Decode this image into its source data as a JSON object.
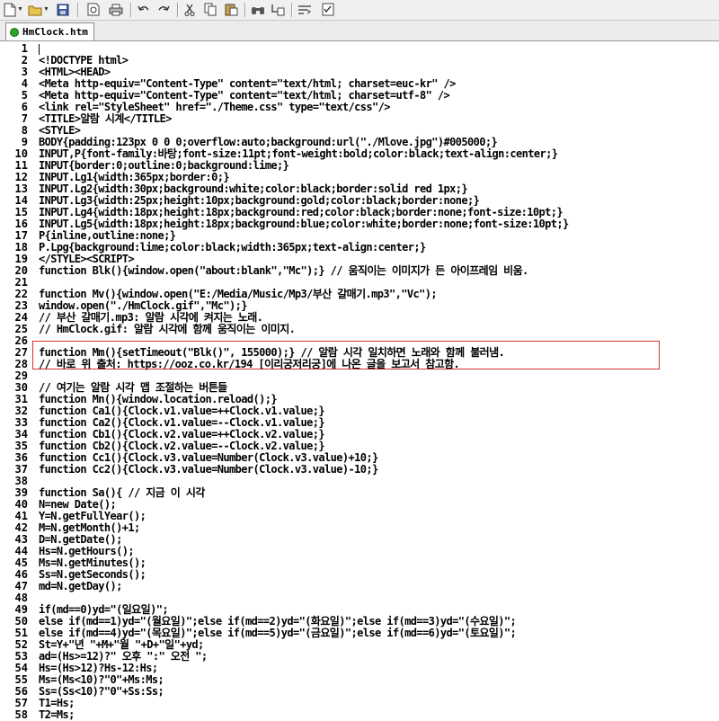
{
  "tab": {
    "label": "HmClock.htm"
  },
  "toolbar": {
    "buttons": [
      "new-file-icon",
      "open-folder-icon",
      "save-icon",
      "print-preview-icon",
      "print-icon",
      "undo-icon",
      "redo-icon",
      "cut-icon",
      "copy-icon",
      "paste-icon",
      "find-icon",
      "replace-icon",
      "wrap-icon",
      "checklist-icon"
    ]
  },
  "lines": [
    {
      "n": "1",
      "t": ""
    },
    {
      "n": "2",
      "t": "<!DOCTYPE html>"
    },
    {
      "n": "3",
      "t": "<HTML><HEAD>"
    },
    {
      "n": "4",
      "t": "<Meta http-equiv=\"Content-Type\" content=\"text/html; charset=euc-kr\" />"
    },
    {
      "n": "5",
      "t": "<Meta http-equiv=\"Content-Type\" content=\"text/html; charset=utf-8\" />"
    },
    {
      "n": "6",
      "t": "<link rel=\"StyleSheet\" href=\"./Theme.css\" type=\"text/css\"/>"
    },
    {
      "n": "7",
      "t": "<TITLE>알람 시계</TITLE>"
    },
    {
      "n": "8",
      "t": "<STYLE>"
    },
    {
      "n": "9",
      "t": "BODY{padding:123px 0 0 0;overflow:auto;background:url(\"./Mlove.jpg\")#005000;}"
    },
    {
      "n": "10",
      "t": "INPUT,P{font-family:바탕;font-size:11pt;font-weight:bold;color:black;text-align:center;}"
    },
    {
      "n": "11",
      "t": "INPUT{border:0;outline:0;background:lime;}"
    },
    {
      "n": "12",
      "t": "INPUT.Lg1{width:365px;border:0;}"
    },
    {
      "n": "13",
      "t": "INPUT.Lg2{width:30px;background:white;color:black;border:solid red 1px;}"
    },
    {
      "n": "14",
      "t": "INPUT.Lg3{width:25px;height:10px;background:gold;color:black;border:none;}"
    },
    {
      "n": "15",
      "t": "INPUT.Lg4{width:18px;height:18px;background:red;color:black;border:none;font-size:10pt;}"
    },
    {
      "n": "16",
      "t": "INPUT.Lg5{width:18px;height:18px;background:blue;color:white;border:none;font-size:10pt;}"
    },
    {
      "n": "17",
      "t": "P{inline,outline:none;}"
    },
    {
      "n": "18",
      "t": "P.Lpg{background:lime;color:black;width:365px;text-align:center;}"
    },
    {
      "n": "19",
      "t": "</STYLE><SCRIPT>"
    },
    {
      "n": "20",
      "t": "function Blk(){window.open(\"about:blank\",\"Mc\");} // 움직이는 이미지가 든 아이프레임 비움."
    },
    {
      "n": "21",
      "t": ""
    },
    {
      "n": "22",
      "t": "function Mv(){window.open(\"E:/Media/Music/Mp3/부산 갈매기.mp3\",\"Vc\");"
    },
    {
      "n": "23",
      "t": "window.open(\"./HmClock.gif\",\"Mc\");}"
    },
    {
      "n": "24",
      "t": "// 부산 갈매기.mp3: 알람 시각에 켜지는 노래."
    },
    {
      "n": "25",
      "t": "// HmClock.gif: 알람 시각에 함께 움직이는 이미지."
    },
    {
      "n": "26",
      "t": ""
    },
    {
      "n": "27",
      "t": "function Mm(){setTimeout(\"Blk()\", 155000);} // 알람 시각 일치하면 노래와 함께 불러냄."
    },
    {
      "n": "28",
      "t": "// 바로 위 출처: https://ooz.co.kr/194 [이리궁저리궁]에 나온 글을 보고서 참고함."
    },
    {
      "n": "29",
      "t": ""
    },
    {
      "n": "30",
      "t": "// 여기는 알람 시각 맵 조절하는 버튼들"
    },
    {
      "n": "31",
      "t": "function Mn(){window.location.reload();}"
    },
    {
      "n": "32",
      "t": "function Ca1(){Clock.v1.value=++Clock.v1.value;}"
    },
    {
      "n": "33",
      "t": "function Ca2(){Clock.v1.value=--Clock.v1.value;}"
    },
    {
      "n": "34",
      "t": "function Cb1(){Clock.v2.value=++Clock.v2.value;}"
    },
    {
      "n": "35",
      "t": "function Cb2(){Clock.v2.value=--Clock.v2.value;}"
    },
    {
      "n": "36",
      "t": "function Cc1(){Clock.v3.value=Number(Clock.v3.value)+10;}"
    },
    {
      "n": "37",
      "t": "function Cc2(){Clock.v3.value=Number(Clock.v3.value)-10;}"
    },
    {
      "n": "38",
      "t": ""
    },
    {
      "n": "39",
      "t": "function Sa(){ // 지금 이 시각"
    },
    {
      "n": "40",
      "t": "N=new Date();"
    },
    {
      "n": "41",
      "t": "Y=N.getFullYear();"
    },
    {
      "n": "42",
      "t": "M=N.getMonth()+1;"
    },
    {
      "n": "43",
      "t": "D=N.getDate();"
    },
    {
      "n": "44",
      "t": "Hs=N.getHours();"
    },
    {
      "n": "45",
      "t": "Ms=N.getMinutes();"
    },
    {
      "n": "46",
      "t": "Ss=N.getSeconds();"
    },
    {
      "n": "47",
      "t": "md=N.getDay();"
    },
    {
      "n": "48",
      "t": ""
    },
    {
      "n": "49",
      "t": "if(md==0)yd=\"(일요일)\";"
    },
    {
      "n": "50",
      "t": "else if(md==1)yd=\"(월요일)\";else if(md==2)yd=\"(화요일)\";else if(md==3)yd=\"(수요일)\";"
    },
    {
      "n": "51",
      "t": "else if(md==4)yd=\"(목요일)\";else if(md==5)yd=\"(금요일)\";else if(md==6)yd=\"(토요일)\";"
    },
    {
      "n": "52",
      "t": "St=Y+\"년 \"+M+\"월 \"+D+\"일\"+yd;"
    },
    {
      "n": "53",
      "t": "ad=(Hs>=12)?\" 오후 \":\" 오전 \";"
    },
    {
      "n": "54",
      "t": "Hs=(Hs>12)?Hs-12:Hs;"
    },
    {
      "n": "55",
      "t": "Ms=(Ms<10)?\"0\"+Ms:Ms;"
    },
    {
      "n": "56",
      "t": "Ss=(Ss<10)?\"0\"+Ss:Ss;"
    },
    {
      "n": "57",
      "t": "T1=Hs;"
    },
    {
      "n": "58",
      "t": "T2=Ms;"
    }
  ]
}
